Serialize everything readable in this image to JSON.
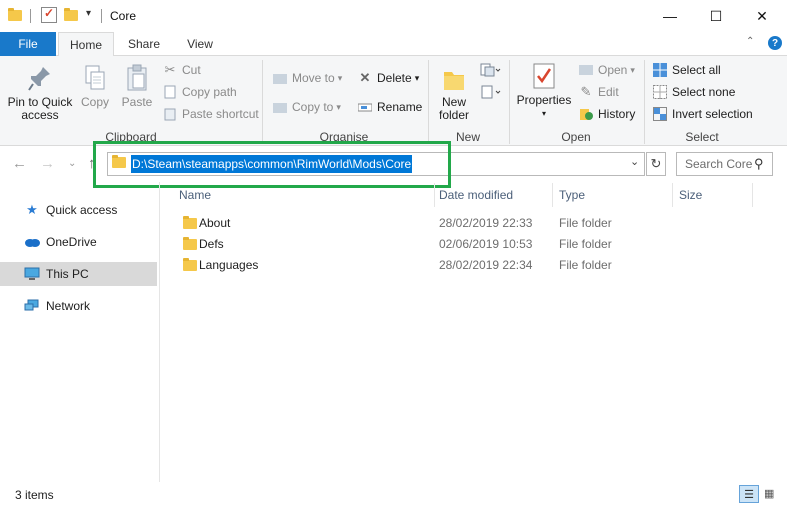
{
  "window": {
    "title": "Core",
    "minimize": "—",
    "maximize": "☐",
    "close": "✕"
  },
  "tabs": {
    "file": "File",
    "home": "Home",
    "share": "Share",
    "view": "View"
  },
  "ribbon": {
    "collapse": "⌃",
    "help": "?",
    "clipboard": {
      "label": "Clipboard",
      "pin_line1": "Pin to Quick",
      "pin_line2": "access",
      "copy": "Copy",
      "paste": "Paste",
      "cut": "Cut",
      "copy_path": "Copy path",
      "paste_shortcut": "Paste shortcut"
    },
    "organise": {
      "label": "Organise",
      "move_to": "Move to",
      "copy_to": "Copy to",
      "delete": "Delete",
      "rename": "Rename"
    },
    "new": {
      "label": "New",
      "new_folder_line1": "New",
      "new_folder_line2": "folder"
    },
    "open": {
      "label": "Open",
      "properties": "Properties",
      "open": "Open",
      "edit": "Edit",
      "history": "History"
    },
    "select": {
      "label": "Select",
      "select_all": "Select all",
      "select_none": "Select none",
      "invert_selection": "Invert selection"
    }
  },
  "address": {
    "path": "D:\\Steam\\steamapps\\common\\RimWorld\\Mods\\Core",
    "search_placeholder": "Search Core"
  },
  "nav": {
    "items": [
      {
        "label": "Quick access",
        "icon": "star-icon"
      },
      {
        "label": "OneDrive",
        "icon": "cloud-icon"
      },
      {
        "label": "This PC",
        "icon": "computer-icon",
        "selected": true
      },
      {
        "label": "Network",
        "icon": "network-icon"
      }
    ]
  },
  "columns": {
    "name": "Name",
    "date_modified": "Date modified",
    "type": "Type",
    "size": "Size"
  },
  "files": [
    {
      "name": "About",
      "date": "28/02/2019 22:33",
      "type": "File folder"
    },
    {
      "name": "Defs",
      "date": "02/06/2019 10:53",
      "type": "File folder"
    },
    {
      "name": "Languages",
      "date": "28/02/2019 22:34",
      "type": "File folder"
    }
  ],
  "status": {
    "items_count": "3 items"
  },
  "colors": {
    "accent": "#1979ca",
    "selection": "#0078d7",
    "highlight_box": "#22a84a",
    "folder": "#f5c84a"
  }
}
